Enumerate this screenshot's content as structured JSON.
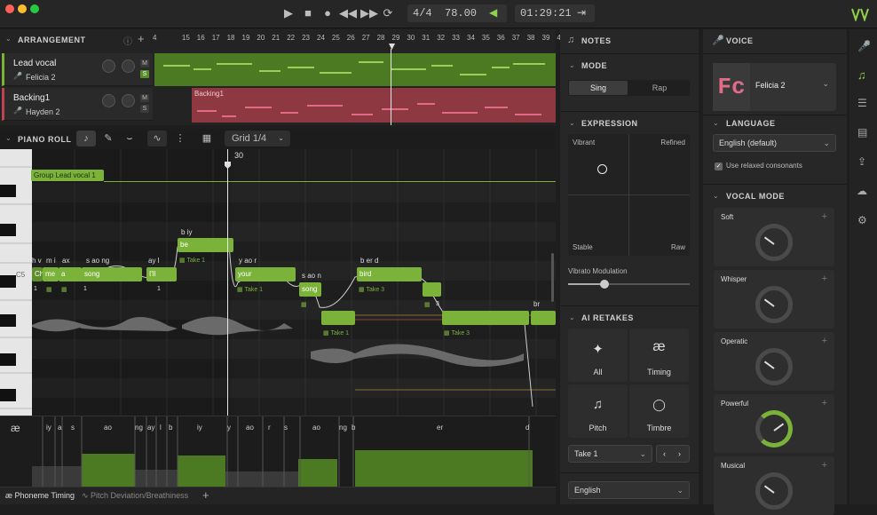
{
  "transport": {
    "time_signature": "4/4",
    "tempo": "78.00",
    "time": "01:29:21"
  },
  "arrangement": {
    "title": "ARRANGEMENT",
    "ruler": [
      "4",
      "15",
      "16",
      "17",
      "18",
      "19",
      "20",
      "21",
      "22",
      "23",
      "24",
      "25",
      "26",
      "27",
      "28",
      "29",
      "30",
      "31",
      "32",
      "33",
      "34",
      "35",
      "36",
      "37",
      "38",
      "39",
      "4"
    ],
    "tracks": [
      {
        "name": "Lead vocal",
        "singer": "Felicia 2",
        "mute": "M",
        "solo": "S"
      },
      {
        "name": "Backing1",
        "singer": "Hayden 2",
        "mute": "M",
        "solo": "S",
        "clip": "Backing1"
      }
    ]
  },
  "piano_roll": {
    "title": "PIANO ROLL",
    "grid": "Grid 1/4",
    "playhead": "30",
    "group_label": "Group Lead vocal 1",
    "key_label": "C5",
    "notes": [
      {
        "lyric": "be",
        "phon": "b iy",
        "take": "Take 1"
      },
      {
        "lyric": "Ch",
        "phon": "h v"
      },
      {
        "lyric": "me",
        "phon": "m i"
      },
      {
        "lyric": "a",
        "phon": "ax"
      },
      {
        "lyric": "song",
        "phon": "s ao ng"
      },
      {
        "lyric": "I'll",
        "phon": "ay l"
      },
      {
        "lyric": "your",
        "phon": "y ao r",
        "take": "Take 1"
      },
      {
        "lyric": "song",
        "phon": "s ao n",
        "take": "Take 1"
      },
      {
        "lyric": "bird",
        "phon": "b er d",
        "take": "Take 3"
      },
      {
        "lyric": "",
        "phon": "br",
        "take": "Take 3"
      }
    ],
    "take_nums": [
      "1",
      "1",
      "1",
      "3"
    ],
    "phonemes": [
      "iy",
      "a",
      "s",
      "ao",
      "ng",
      "ay",
      "l",
      "b",
      "iy",
      "y",
      "ao",
      "r",
      "s",
      "ao",
      "ng",
      "b",
      "er",
      "d"
    ],
    "phoneme_icon": "æ",
    "tabs": [
      "Phoneme Timing",
      "Pitch Deviation/Breathiness"
    ],
    "add": "+"
  },
  "notes_panel": {
    "title": "NOTES",
    "mode_title": "MODE",
    "modes": [
      "Sing",
      "Rap"
    ],
    "expression_title": "EXPRESSION",
    "corners": [
      "Vibrant",
      "Refined",
      "Stable",
      "Raw"
    ],
    "vibrato_label": "Vibrato Modulation",
    "vibrato_value": 0.3,
    "retakes_title": "AI RETAKES",
    "retake_tiles": [
      {
        "label": "All",
        "icon": "sparkles-icon"
      },
      {
        "label": "Timing",
        "icon": "ae-icon",
        "glyph": "æ"
      },
      {
        "label": "Pitch",
        "icon": "music-note-icon"
      },
      {
        "label": "Timbre",
        "icon": "lips-icon"
      }
    ],
    "take_select": "Take 1",
    "language_select": "English"
  },
  "voice_panel": {
    "title": "VOICE",
    "voice_name": "Felicia 2",
    "avatar_initials": "Fc",
    "language_title": "LANGUAGE",
    "language": "English (default)",
    "relaxed": "Use relaxed consonants",
    "mode_title": "VOCAL MODE",
    "modes": [
      {
        "name": "Soft",
        "level": 0.3
      },
      {
        "name": "Whisper",
        "level": 0.3
      },
      {
        "name": "Operatic",
        "level": 0.3
      },
      {
        "name": "Powerful",
        "level": 0.7
      },
      {
        "name": "Musical",
        "level": 0.3
      }
    ]
  },
  "colors": {
    "accent": "#7bb23a",
    "backing": "#c0444f",
    "pink": "#e26b8a"
  }
}
